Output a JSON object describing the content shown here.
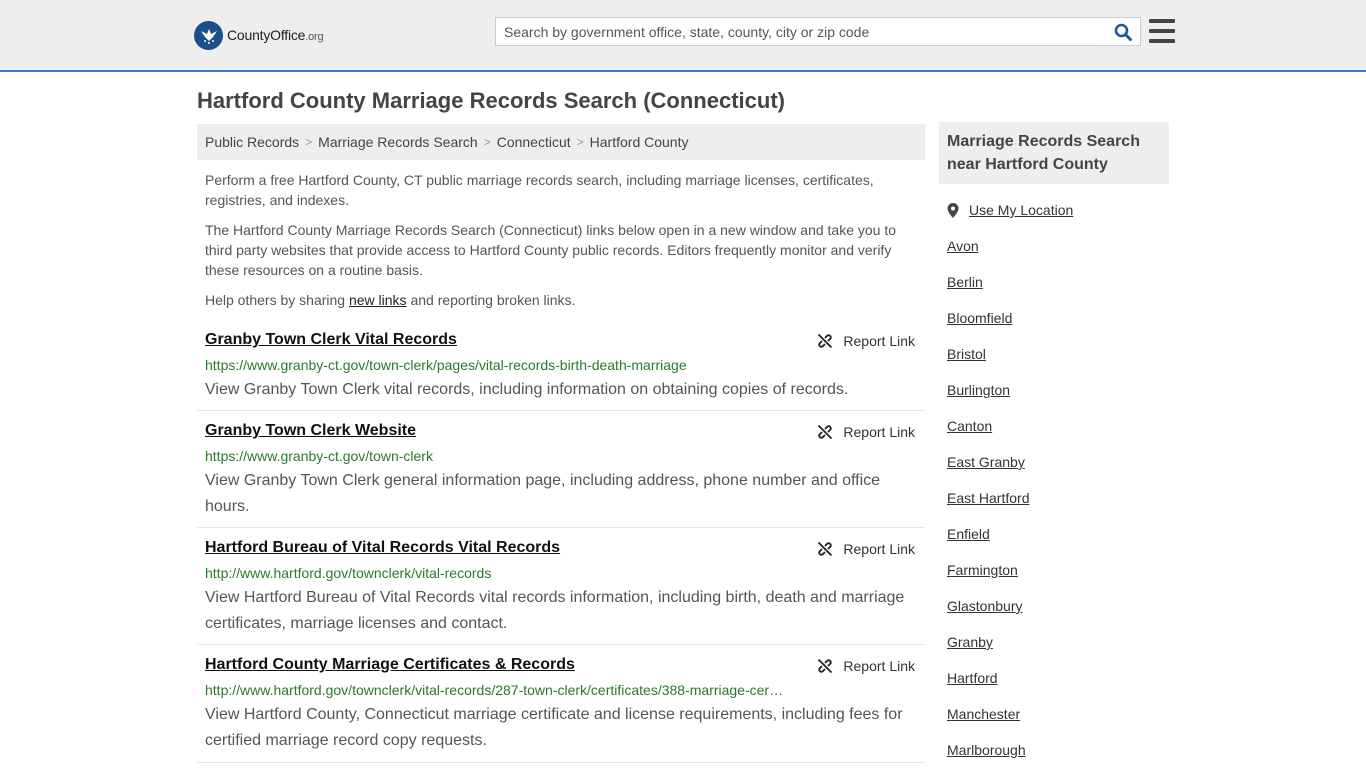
{
  "header": {
    "logo_word": "CountyOffice",
    "logo_tld": ".org",
    "search_placeholder": "Search by government office, state, county, city or zip code"
  },
  "page_title": "Hartford County Marriage Records Search (Connecticut)",
  "breadcrumbs": [
    "Public Records",
    "Marriage Records Search",
    "Connecticut",
    "Hartford County"
  ],
  "intro": {
    "p1": "Perform a free Hartford County, CT public marriage records search, including marriage licenses, certificates, registries, and indexes.",
    "p2": "The Hartford County Marriage Records Search (Connecticut) links below open in a new window and take you to third party websites that provide access to Hartford County public records. Editors frequently monitor and verify these resources on a routine basis.",
    "p3_before": "Help others by sharing ",
    "p3_link": "new links",
    "p3_after": " and reporting broken links."
  },
  "report_label": "Report Link",
  "results": [
    {
      "title": "Granby Town Clerk Vital Records",
      "url": "https://www.granby-ct.gov/town-clerk/pages/vital-records-birth-death-marriage",
      "desc": "View Granby Town Clerk vital records, including information on obtaining copies of records."
    },
    {
      "title": "Granby Town Clerk Website",
      "url": "https://www.granby-ct.gov/town-clerk",
      "desc": "View Granby Town Clerk general information page, including address, phone number and office hours."
    },
    {
      "title": "Hartford Bureau of Vital Records Vital Records",
      "url": "http://www.hartford.gov/townclerk/vital-records",
      "desc": "View Hartford Bureau of Vital Records vital records information, including birth, death and marriage certificates, marriage licenses and contact."
    },
    {
      "title": "Hartford County Marriage Certificates & Records",
      "url": "http://www.hartford.gov/townclerk/vital-records/287-town-clerk/certificates/388-marriage-cer…",
      "desc": "View Hartford County, Connecticut marriage certificate and license requirements, including fees for certified marriage record copy requests."
    }
  ],
  "sidebar": {
    "heading": "Marriage Records Search near Hartford County",
    "use_location": "Use My Location",
    "towns": [
      "Avon",
      "Berlin",
      "Bloomfield",
      "Bristol",
      "Burlington",
      "Canton",
      "East Granby",
      "East Hartford",
      "Enfield",
      "Farmington",
      "Glastonbury",
      "Granby",
      "Hartford",
      "Manchester",
      "Marlborough"
    ]
  }
}
